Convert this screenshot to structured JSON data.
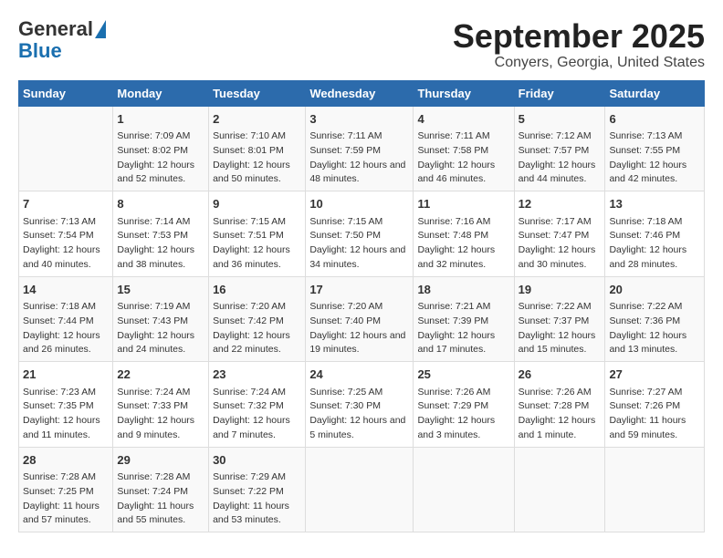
{
  "logo": {
    "line1": "General",
    "line2": "Blue"
  },
  "title": "September 2025",
  "subtitle": "Conyers, Georgia, United States",
  "headers": [
    "Sunday",
    "Monday",
    "Tuesday",
    "Wednesday",
    "Thursday",
    "Friday",
    "Saturday"
  ],
  "weeks": [
    [
      {
        "day": "",
        "sunrise": "",
        "sunset": "",
        "daylight": ""
      },
      {
        "day": "1",
        "sunrise": "Sunrise: 7:09 AM",
        "sunset": "Sunset: 8:02 PM",
        "daylight": "Daylight: 12 hours and 52 minutes."
      },
      {
        "day": "2",
        "sunrise": "Sunrise: 7:10 AM",
        "sunset": "Sunset: 8:01 PM",
        "daylight": "Daylight: 12 hours and 50 minutes."
      },
      {
        "day": "3",
        "sunrise": "Sunrise: 7:11 AM",
        "sunset": "Sunset: 7:59 PM",
        "daylight": "Daylight: 12 hours and 48 minutes."
      },
      {
        "day": "4",
        "sunrise": "Sunrise: 7:11 AM",
        "sunset": "Sunset: 7:58 PM",
        "daylight": "Daylight: 12 hours and 46 minutes."
      },
      {
        "day": "5",
        "sunrise": "Sunrise: 7:12 AM",
        "sunset": "Sunset: 7:57 PM",
        "daylight": "Daylight: 12 hours and 44 minutes."
      },
      {
        "day": "6",
        "sunrise": "Sunrise: 7:13 AM",
        "sunset": "Sunset: 7:55 PM",
        "daylight": "Daylight: 12 hours and 42 minutes."
      }
    ],
    [
      {
        "day": "7",
        "sunrise": "Sunrise: 7:13 AM",
        "sunset": "Sunset: 7:54 PM",
        "daylight": "Daylight: 12 hours and 40 minutes."
      },
      {
        "day": "8",
        "sunrise": "Sunrise: 7:14 AM",
        "sunset": "Sunset: 7:53 PM",
        "daylight": "Daylight: 12 hours and 38 minutes."
      },
      {
        "day": "9",
        "sunrise": "Sunrise: 7:15 AM",
        "sunset": "Sunset: 7:51 PM",
        "daylight": "Daylight: 12 hours and 36 minutes."
      },
      {
        "day": "10",
        "sunrise": "Sunrise: 7:15 AM",
        "sunset": "Sunset: 7:50 PM",
        "daylight": "Daylight: 12 hours and 34 minutes."
      },
      {
        "day": "11",
        "sunrise": "Sunrise: 7:16 AM",
        "sunset": "Sunset: 7:48 PM",
        "daylight": "Daylight: 12 hours and 32 minutes."
      },
      {
        "day": "12",
        "sunrise": "Sunrise: 7:17 AM",
        "sunset": "Sunset: 7:47 PM",
        "daylight": "Daylight: 12 hours and 30 minutes."
      },
      {
        "day": "13",
        "sunrise": "Sunrise: 7:18 AM",
        "sunset": "Sunset: 7:46 PM",
        "daylight": "Daylight: 12 hours and 28 minutes."
      }
    ],
    [
      {
        "day": "14",
        "sunrise": "Sunrise: 7:18 AM",
        "sunset": "Sunset: 7:44 PM",
        "daylight": "Daylight: 12 hours and 26 minutes."
      },
      {
        "day": "15",
        "sunrise": "Sunrise: 7:19 AM",
        "sunset": "Sunset: 7:43 PM",
        "daylight": "Daylight: 12 hours and 24 minutes."
      },
      {
        "day": "16",
        "sunrise": "Sunrise: 7:20 AM",
        "sunset": "Sunset: 7:42 PM",
        "daylight": "Daylight: 12 hours and 22 minutes."
      },
      {
        "day": "17",
        "sunrise": "Sunrise: 7:20 AM",
        "sunset": "Sunset: 7:40 PM",
        "daylight": "Daylight: 12 hours and 19 minutes."
      },
      {
        "day": "18",
        "sunrise": "Sunrise: 7:21 AM",
        "sunset": "Sunset: 7:39 PM",
        "daylight": "Daylight: 12 hours and 17 minutes."
      },
      {
        "day": "19",
        "sunrise": "Sunrise: 7:22 AM",
        "sunset": "Sunset: 7:37 PM",
        "daylight": "Daylight: 12 hours and 15 minutes."
      },
      {
        "day": "20",
        "sunrise": "Sunrise: 7:22 AM",
        "sunset": "Sunset: 7:36 PM",
        "daylight": "Daylight: 12 hours and 13 minutes."
      }
    ],
    [
      {
        "day": "21",
        "sunrise": "Sunrise: 7:23 AM",
        "sunset": "Sunset: 7:35 PM",
        "daylight": "Daylight: 12 hours and 11 minutes."
      },
      {
        "day": "22",
        "sunrise": "Sunrise: 7:24 AM",
        "sunset": "Sunset: 7:33 PM",
        "daylight": "Daylight: 12 hours and 9 minutes."
      },
      {
        "day": "23",
        "sunrise": "Sunrise: 7:24 AM",
        "sunset": "Sunset: 7:32 PM",
        "daylight": "Daylight: 12 hours and 7 minutes."
      },
      {
        "day": "24",
        "sunrise": "Sunrise: 7:25 AM",
        "sunset": "Sunset: 7:30 PM",
        "daylight": "Daylight: 12 hours and 5 minutes."
      },
      {
        "day": "25",
        "sunrise": "Sunrise: 7:26 AM",
        "sunset": "Sunset: 7:29 PM",
        "daylight": "Daylight: 12 hours and 3 minutes."
      },
      {
        "day": "26",
        "sunrise": "Sunrise: 7:26 AM",
        "sunset": "Sunset: 7:28 PM",
        "daylight": "Daylight: 12 hours and 1 minute."
      },
      {
        "day": "27",
        "sunrise": "Sunrise: 7:27 AM",
        "sunset": "Sunset: 7:26 PM",
        "daylight": "Daylight: 11 hours and 59 minutes."
      }
    ],
    [
      {
        "day": "28",
        "sunrise": "Sunrise: 7:28 AM",
        "sunset": "Sunset: 7:25 PM",
        "daylight": "Daylight: 11 hours and 57 minutes."
      },
      {
        "day": "29",
        "sunrise": "Sunrise: 7:28 AM",
        "sunset": "Sunset: 7:24 PM",
        "daylight": "Daylight: 11 hours and 55 minutes."
      },
      {
        "day": "30",
        "sunrise": "Sunrise: 7:29 AM",
        "sunset": "Sunset: 7:22 PM",
        "daylight": "Daylight: 11 hours and 53 minutes."
      },
      {
        "day": "",
        "sunrise": "",
        "sunset": "",
        "daylight": ""
      },
      {
        "day": "",
        "sunrise": "",
        "sunset": "",
        "daylight": ""
      },
      {
        "day": "",
        "sunrise": "",
        "sunset": "",
        "daylight": ""
      },
      {
        "day": "",
        "sunrise": "",
        "sunset": "",
        "daylight": ""
      }
    ]
  ]
}
